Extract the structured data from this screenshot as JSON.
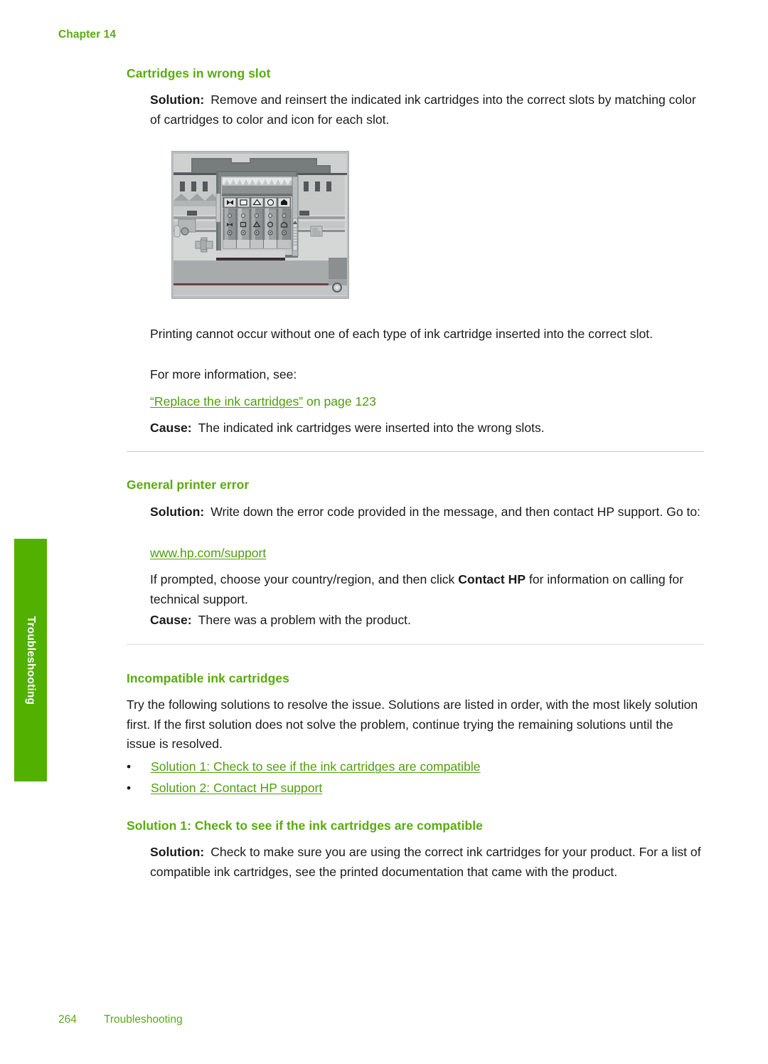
{
  "header": {
    "chapter": "Chapter 14"
  },
  "side_tab": {
    "label": "Troubleshooting",
    "color": "#52b000"
  },
  "colors": {
    "heading_green": "#5aab10",
    "link_green": "#4f9e0c",
    "tab_green": "#52b000",
    "rule_gray": "#c6c8c9",
    "body_black": "#1a1a1a"
  },
  "sections": [
    {
      "heading": "Cartridges in wrong slot",
      "solution_label": "Solution:",
      "solution_text": "Remove and reinsert the indicated ink cartridges into the correct slots by matching color of cartridges to color and icon for each slot.",
      "figure": {
        "alt": "printer-carriage-with-five-ink-cartridge-slots",
        "slot_icons": [
          "bowtie-icon",
          "square-icon",
          "triangle-icon",
          "circle-icon",
          "pentagon-icon"
        ]
      },
      "body_1": "Printing cannot occur without one of each type of ink cartridge inserted into the correct slot.",
      "body_2": "For more information, see:",
      "cross_reference": {
        "link_text": "“Replace the ink cartridges”",
        "tail_text": " on page 123"
      },
      "cause_label": "Cause:",
      "cause_text": "The indicated ink cartridges were inserted into the wrong slots."
    },
    {
      "heading": "General printer error",
      "solution_label": "Solution:",
      "solution_text": "Write down the error code provided in the message, and then contact HP support. Go to:",
      "url": "www.hp.com/support",
      "body_1_pre": "If prompted, choose your country/region, and then click ",
      "body_1_bold": "Contact HP",
      "body_1_post": " for information on calling for technical support.",
      "cause_label": "Cause:",
      "cause_text": "There was a problem with the product."
    },
    {
      "heading": "Incompatible ink cartridges",
      "intro": "Try the following solutions to resolve the issue. Solutions are listed in order, with the most likely solution first. If the first solution does not solve the problem, continue trying the remaining solutions until the issue is resolved.",
      "bullet_marker": "•",
      "links": [
        "Solution 1: Check to see if the ink cartridges are compatible",
        "Solution 2: Contact HP support"
      ],
      "sub_heading": "Solution 1: Check to see if the ink cartridges are compatible",
      "solution_label": "Solution:",
      "solution_text": "Check to make sure you are using the correct ink cartridges for your product. For a list of compatible ink cartridges, see the printed documentation that came with the product."
    }
  ],
  "footer": {
    "page_number": "264",
    "section_name": "Troubleshooting"
  }
}
